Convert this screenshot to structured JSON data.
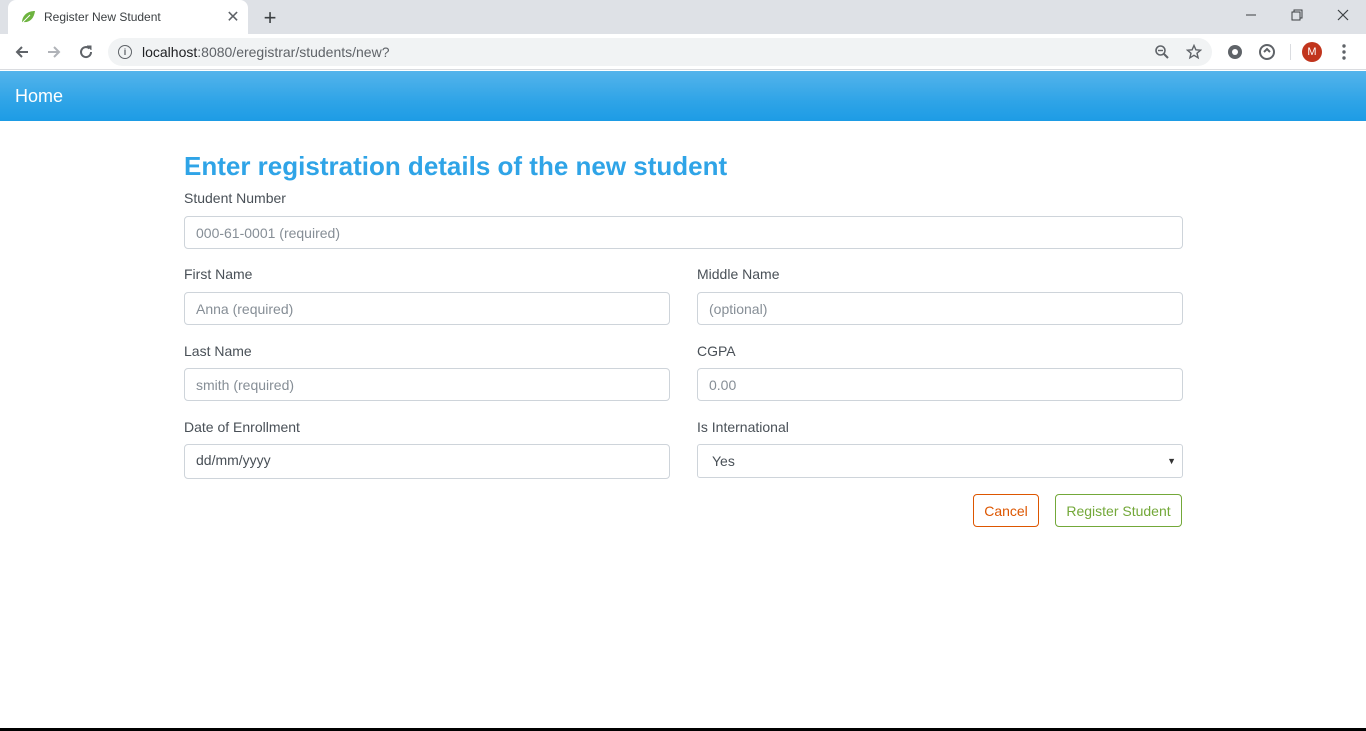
{
  "browser": {
    "tab_title": "Register New Student",
    "tab_close": "✕",
    "new_tab": "+",
    "url_host": "localhost",
    "url_rest": ":8080/eregistrar/students/new?",
    "profile_initial": "M",
    "icons": [
      "back-icon",
      "forward-icon",
      "reload-icon",
      "info-icon",
      "zoom-icon",
      "star-icon",
      "extension-icon",
      "sync-icon",
      "menu-icon"
    ]
  },
  "navbar": {
    "brand": "Home"
  },
  "form": {
    "heading": "Enter registration details of the new student",
    "student_number": {
      "label": "Student Number",
      "placeholder": "000-61-0001 (required)"
    },
    "first_name": {
      "label": "First Name",
      "placeholder": "Anna (required)"
    },
    "middle_name": {
      "label": "Middle Name",
      "placeholder": "(optional)"
    },
    "last_name": {
      "label": "Last Name",
      "placeholder": "smith (required)"
    },
    "cgpa": {
      "label": "CGPA",
      "placeholder": "0.00"
    },
    "enrollment_date": {
      "label": "Date of Enrollment",
      "value": "dd/mm/yyyy"
    },
    "is_international": {
      "label": "Is International",
      "selected": "Yes"
    },
    "cancel_label": "Cancel",
    "register_label": "Register Student"
  },
  "colors": {
    "primary": "#2fa4e7",
    "cancel": "#dd5600",
    "register": "#73a839"
  }
}
